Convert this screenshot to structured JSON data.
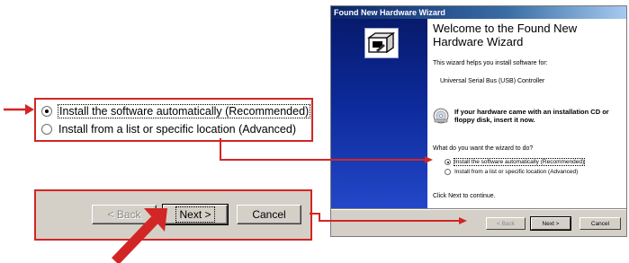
{
  "callout_options": {
    "options": [
      {
        "label": "Install the software automatically (Recommended)",
        "selected": true
      },
      {
        "label": "Install from a list or specific location (Advanced)",
        "selected": false
      }
    ]
  },
  "callout_buttons": {
    "back_label": "< Back",
    "next_label": "Next >",
    "cancel_label": "Cancel"
  },
  "wizard": {
    "title": "Found New Hardware Wizard",
    "heading": "Welcome to the Found New Hardware Wizard",
    "description": "This wizard helps you install software for:",
    "device": "Universal Serial Bus (USB) Controller",
    "cd_note": "If your hardware came with an installation CD or floppy disk, insert it now.",
    "question": "What do you want the wizard to do?",
    "options": [
      {
        "label": "Install the software automatically (Recommended)",
        "selected": true
      },
      {
        "label": "Install from a list or specific location (Advanced)",
        "selected": false
      }
    ],
    "continue_text": "Click Next to continue.",
    "back_label": "< Back",
    "next_label": "Next >",
    "cancel_label": "Cancel"
  },
  "colors": {
    "annotation_red": "#d22626",
    "dialog_gray": "#d4d0c8",
    "side_panel_blue": "#0c2a9a"
  },
  "icons": {
    "wizard_logo": "hardware-box-icon",
    "cd_icon": "cd-disc-icon"
  }
}
